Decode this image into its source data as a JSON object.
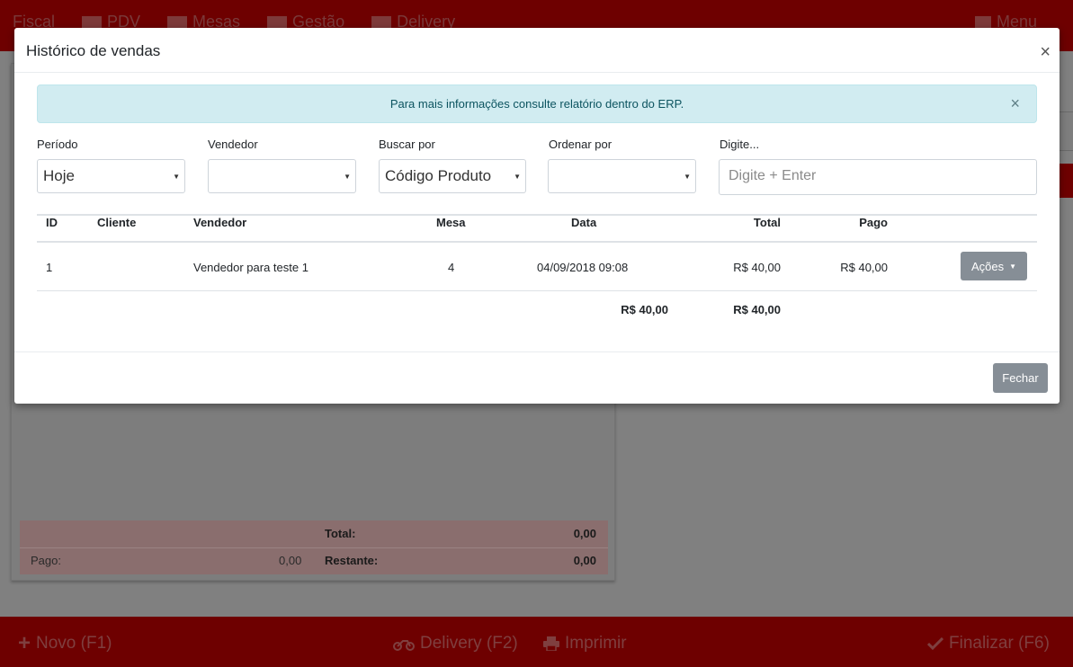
{
  "topbar": {
    "nav": [
      "Fiscal",
      "PDV",
      "Mesas",
      "Gestão",
      "Delivery"
    ],
    "menu_label": "Menu"
  },
  "bottombar": {
    "novo": "Novo (F1)",
    "delivery": "Delivery (F2)",
    "imprimir": "Imprimir",
    "finalizar": "Finalizar (F6)"
  },
  "totals": {
    "total_label": "Total:",
    "total_value": "0,00",
    "pago_label": "Pago:",
    "pago_value": "0,00",
    "restante_label": "Restante:",
    "restante_value": "0,00"
  },
  "modal": {
    "title": "Histórico de vendas",
    "close": "×",
    "alert_text": "Para mais informações consulte relatório dentro do ERP.",
    "alert_close": "×",
    "filters": {
      "periodo_label": "Período",
      "periodo_value": "Hoje",
      "vendedor_label": "Vendedor",
      "vendedor_value": "",
      "buscar_label": "Buscar por",
      "buscar_value": "Código Produto",
      "ordenar_label": "Ordenar por",
      "ordenar_value": "",
      "digite_label": "Digite...",
      "digite_placeholder": "Digite + Enter"
    },
    "table": {
      "headers": {
        "id": "ID",
        "cliente": "Cliente",
        "vendedor": "Vendedor",
        "mesa": "Mesa",
        "data": "Data",
        "total": "Total",
        "pago": "Pago"
      },
      "rows": [
        {
          "id": "1",
          "cliente": "",
          "vendedor": "Vendedor para teste 1",
          "mesa": "4",
          "data": "04/09/2018 09:08",
          "total": "R$ 40,00",
          "pago": "R$ 40,00",
          "acoes_label": "Ações"
        }
      ],
      "footer": {
        "total": "R$ 40,00",
        "pago": "R$ 40,00"
      }
    },
    "fechar_label": "Fechar"
  },
  "colors": {
    "brand_red": "#6e0000",
    "alert_bg": "#d1ecf1",
    "button_gray": "#868e96"
  }
}
